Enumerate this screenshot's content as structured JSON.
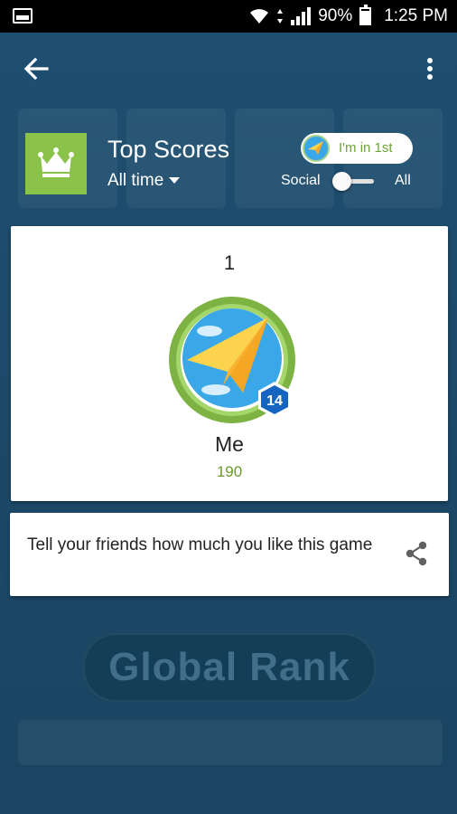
{
  "status_bar": {
    "battery_text": "90%",
    "time": "1:25 PM",
    "battery_level": 0.9
  },
  "header": {
    "title": "Top Scores",
    "timeframe": "All time",
    "im_in_label": "I'm in 1st",
    "social_label": "Social",
    "all_label": "All"
  },
  "background": {
    "button_label": "Global  Rank"
  },
  "leader": {
    "rank": "1",
    "name": "Me",
    "score": "190",
    "level": "14"
  },
  "share": {
    "text": "Tell your friends how much you like this game"
  },
  "colors": {
    "accent_green": "#8bc34a",
    "score_green": "#6b9b2f",
    "background_blue": "#1e4f70",
    "badge_blue": "#1565c0"
  }
}
